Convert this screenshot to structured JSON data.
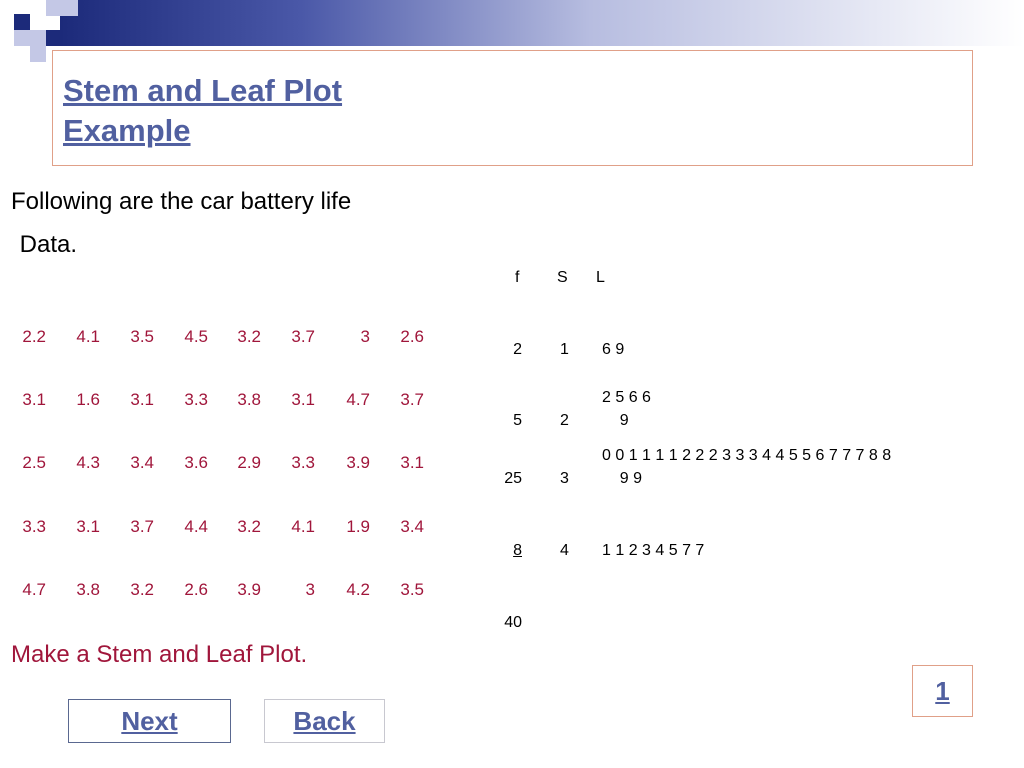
{
  "title": {
    "line1": "Stem and Leaf Plot",
    "line2": "Example"
  },
  "intro": {
    "line1": "Following are the car battery life",
    "line2": " Data."
  },
  "data_table": {
    "rows": [
      [
        "2.2",
        "4.1",
        "3.5",
        "4.5",
        "3.2",
        "3.7",
        "3",
        "2.6"
      ],
      [
        "3.1",
        "1.6",
        "3.1",
        "3.3",
        "3.8",
        "3.1",
        "4.7",
        "3.7"
      ],
      [
        "2.5",
        "4.3",
        "3.4",
        "3.6",
        "2.9",
        "3.3",
        "3.9",
        "3.1"
      ],
      [
        "3.3",
        "3.1",
        "3.7",
        "4.4",
        "3.2",
        "4.1",
        "1.9",
        "3.4"
      ],
      [
        "4.7",
        "3.8",
        "3.2",
        "2.6",
        "3.9",
        "3",
        "4.2",
        "3.5"
      ]
    ]
  },
  "stem_leaf": {
    "headers": {
      "f": "f",
      "s": "S",
      "l": "L"
    },
    "rows": [
      {
        "f": "2",
        "s": "1",
        "l1": "6 9",
        "l2": ""
      },
      {
        "f": "5",
        "s": "2",
        "l1": "2 5 6 6",
        "l2": "    9"
      },
      {
        "f": "25",
        "s": "3",
        "l1": "0 0 1 1 1 1 2 2 2 3 3 3 4 4 5 5 6 7 7 7 8 8",
        "l2": "    9 9"
      },
      {
        "f": "8",
        "s": "4",
        "l1": "1 1 2 3 4 5 7 7",
        "l2": ""
      }
    ],
    "total": "40"
  },
  "prompt": "Make a Stem and Leaf Plot.",
  "nav": {
    "next": "Next",
    "back": "Back",
    "page": "1"
  },
  "colors": {
    "accent": "#5160a0",
    "data": "#a0163b",
    "border": "#e0a088",
    "header_dark": "#1c2a7a"
  }
}
